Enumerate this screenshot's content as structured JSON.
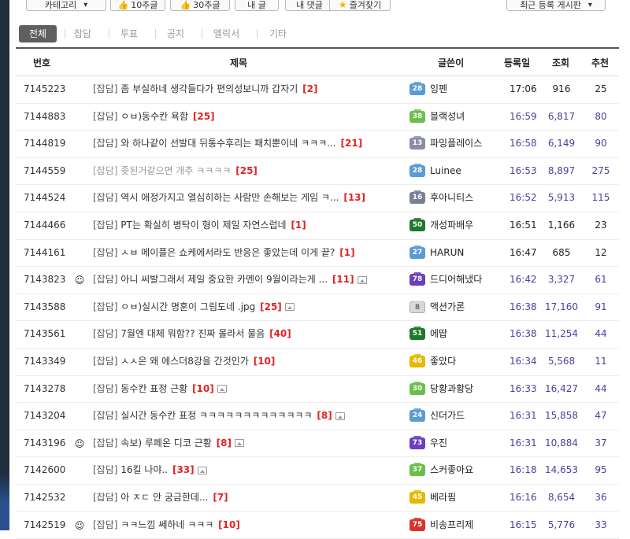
{
  "toolbar": {
    "category_label": "카테고리",
    "recommend10_label": "10추글",
    "recommend30_label": "30추글",
    "my_posts_label": "내 글",
    "my_comments_label": "내 댓글",
    "favorites_label": "즐겨찾기",
    "sort_label": "최근 등록 게시판"
  },
  "tabs": [
    "전체",
    "잡담",
    "투표",
    "공지",
    "엘릭서",
    "기타"
  ],
  "columns": {
    "number": "번호",
    "title": "제목",
    "writer": "글쓴이",
    "date": "등록일",
    "views": "조회",
    "recommend": "추천"
  },
  "colors": {
    "accent_purple": "#4b3fa0",
    "comment_red": "#e02424",
    "active_tab": "#5f5f5f"
  },
  "rows": [
    {
      "num": "7145223",
      "icon": "",
      "cat": "[잡담]",
      "title": "좀 부실하네 생각들다가 편의성보니까 갑자기",
      "comments": "[2]",
      "img": false,
      "muted": false,
      "level": "28",
      "badge_color": "#5b9bd5",
      "writer": "잉펜",
      "time": "17:06",
      "views": "916",
      "rec": "25",
      "dark": true
    },
    {
      "num": "7144883",
      "icon": "",
      "cat": "[잡담]",
      "title": "ㅇㅂ)동수칸 욕함",
      "comments": "[25]",
      "img": false,
      "muted": false,
      "level": "38",
      "badge_color": "#6abf4b",
      "writer": "블랙성녀",
      "time": "16:59",
      "views": "6,817",
      "rec": "80",
      "dark": false
    },
    {
      "num": "7144819",
      "icon": "",
      "cat": "[잡담]",
      "title": "와 하나같이 선발대 뒤통수후리는 패치뿐이네 ㅋㅋㅋ...",
      "comments": "[21]",
      "img": false,
      "muted": false,
      "level": "13",
      "badge_color": "#8a8fa0",
      "writer": "파밍플레이스",
      "time": "16:58",
      "views": "6,149",
      "rec": "90",
      "dark": false
    },
    {
      "num": "7144559",
      "icon": "",
      "cat": "[잡담]",
      "title": "좆된거같으면 개추 ㅋㅋㅋㅋ",
      "comments": "[25]",
      "img": false,
      "muted": true,
      "level": "28",
      "badge_color": "#5b9bd5",
      "writer": "Luinee",
      "time": "16:53",
      "views": "8,897",
      "rec": "275",
      "dark": false
    },
    {
      "num": "7144524",
      "icon": "",
      "cat": "[잡담]",
      "title": "역시 애정가지고 열심히하는 사람만 손해보는 게임 ㅋ...",
      "comments": "[13]",
      "img": false,
      "muted": false,
      "level": "16",
      "badge_color": "#7a8094",
      "writer": "후아니티스",
      "time": "16:52",
      "views": "5,913",
      "rec": "115",
      "dark": false
    },
    {
      "num": "7144466",
      "icon": "",
      "cat": "[잡담]",
      "title": "PT는 확실히 병탁이 형이 제일 자연스럽네",
      "comments": "[1]",
      "img": false,
      "muted": false,
      "level": "50",
      "badge_color": "#1e7a2a",
      "writer": "개성파배우",
      "time": "16:51",
      "views": "1,166",
      "rec": "23",
      "dark": true
    },
    {
      "num": "7144161",
      "icon": "",
      "cat": "[잡담]",
      "title": "ㅅㅂ 메이플은 쇼케에서라도 반응은 좋았는데 이게 끝?",
      "comments": "[1]",
      "img": false,
      "muted": false,
      "level": "27",
      "badge_color": "#5b9bd5",
      "writer": "HARUN",
      "time": "16:47",
      "views": "685",
      "rec": "12",
      "dark": true
    },
    {
      "num": "7143823",
      "icon": "avatar",
      "cat": "[잡담]",
      "title": "아니 씨발그래서 제일 중요한 카멘이 9월이라는게 ...",
      "comments": "[11]",
      "img": true,
      "muted": false,
      "level": "78",
      "badge_color": "#6a3fc0",
      "writer": "드디어해냈다",
      "time": "16:42",
      "views": "3,327",
      "rec": "61",
      "dark": false
    },
    {
      "num": "7143588",
      "icon": "",
      "cat": "[잡담]",
      "title": "ㅇㅂ)실시간 명훈이 그림도네 .jpg",
      "comments": "[25]",
      "img": true,
      "muted": false,
      "level": "8",
      "badge_color": "#d9d9d9",
      "writer": "액션가론",
      "time": "16:38",
      "views": "17,160",
      "rec": "91",
      "dark": false
    },
    {
      "num": "7143561",
      "icon": "",
      "cat": "[잡담]",
      "title": "7월엔 대체 뭐함?? 진짜 몰라서 물음",
      "comments": "[40]",
      "img": false,
      "muted": false,
      "level": "51",
      "badge_color": "#1e7a2a",
      "writer": "에땁",
      "time": "16:38",
      "views": "11,254",
      "rec": "44",
      "dark": false
    },
    {
      "num": "7143349",
      "icon": "",
      "cat": "[잡담]",
      "title": "ㅅㅅ은 왜 에스더8강을 간것인가",
      "comments": "[10]",
      "img": false,
      "muted": false,
      "level": "46",
      "badge_color": "#e6b800",
      "writer": "좋았다",
      "time": "16:34",
      "views": "5,568",
      "rec": "11",
      "dark": false
    },
    {
      "num": "7143278",
      "icon": "",
      "cat": "[잡담]",
      "title": "동수칸 표정 근황",
      "comments": "[10]",
      "img": true,
      "muted": false,
      "level": "30",
      "badge_color": "#6abf4b",
      "writer": "당황과황당",
      "time": "16:33",
      "views": "16,427",
      "rec": "44",
      "dark": false
    },
    {
      "num": "7143204",
      "icon": "",
      "cat": "[잡담]",
      "title": "실시간 동수칸 표정 ㅋㅋㅋㅋㅋㅋㅋㅋㅋㅋㅋㅋㅋ",
      "comments": "[8]",
      "img": true,
      "muted": false,
      "level": "24",
      "badge_color": "#5b9bd5",
      "writer": "신더가드",
      "time": "16:31",
      "views": "15,858",
      "rec": "47",
      "dark": false
    },
    {
      "num": "7143196",
      "icon": "avatar",
      "cat": "[잡담]",
      "title": "속보) 루페온 디코 근황",
      "comments": "[8]",
      "img": true,
      "muted": false,
      "level": "73",
      "badge_color": "#6a3fc0",
      "writer": "우진",
      "time": "16:31",
      "views": "10,884",
      "rec": "37",
      "dark": false
    },
    {
      "num": "7142600",
      "icon": "",
      "cat": "[잡담]",
      "title": "16킬 나야..",
      "comments": "[33]",
      "img": true,
      "muted": false,
      "level": "37",
      "badge_color": "#6abf4b",
      "writer": "스커좋아요",
      "time": "16:18",
      "views": "14,653",
      "rec": "95",
      "dark": false
    },
    {
      "num": "7142532",
      "icon": "",
      "cat": "[잡담]",
      "title": "아 ㅈㄷ 안 궁금한데...",
      "comments": "[7]",
      "img": false,
      "muted": false,
      "level": "45",
      "badge_color": "#e6b800",
      "writer": "베라핌",
      "time": "16:16",
      "views": "8,654",
      "rec": "36",
      "dark": false
    },
    {
      "num": "7142519",
      "icon": "avatar",
      "cat": "[잡담]",
      "title": "ㅋㅋ느낌 쎄하네 ㅋㅋㅋ",
      "comments": "[10]",
      "img": false,
      "muted": false,
      "level": "75",
      "badge_color": "#d9342b",
      "writer": "비송프리제",
      "time": "16:15",
      "views": "5,776",
      "rec": "33",
      "dark": false
    }
  ]
}
